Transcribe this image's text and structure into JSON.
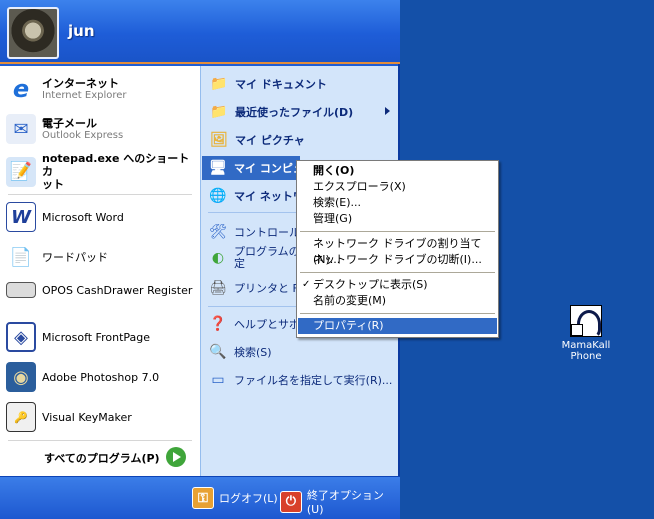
{
  "user": {
    "name": "jun"
  },
  "left_items": [
    {
      "title": "インターネット",
      "sub": "Internet Explorer"
    },
    {
      "title": "電子メール",
      "sub": "Outlook Express"
    },
    {
      "title": "notepad.exe へのショートカ",
      "title2": "ット"
    },
    {
      "title": "Microsoft Word"
    },
    {
      "title": "ワードパッド"
    },
    {
      "title": "OPOS CashDrawer Register"
    },
    {
      "title": "Microsoft FrontPage"
    },
    {
      "title": "Adobe Photoshop 7.0"
    },
    {
      "title": "Visual KeyMaker"
    }
  ],
  "all_programs": "すべてのプログラム(P)",
  "right_items": [
    {
      "label": "マイ ドキュメント"
    },
    {
      "label": "最近使ったファイル(D)"
    },
    {
      "label": "マイ ピクチャ"
    },
    {
      "label": "マイ コンピュ"
    },
    {
      "label": "マイ ネットワ"
    },
    {
      "label": "コントロール"
    },
    {
      "label": "プログラムのア",
      "label2": "定"
    },
    {
      "label": "プリンタと FA"
    },
    {
      "label": "ヘルプとサポ"
    },
    {
      "label": "検索(S)"
    },
    {
      "label": "ファイル名を指定して実行(R)..."
    }
  ],
  "footer": {
    "logoff": "ログオフ(L)",
    "shutdown": "終了オプション(U)"
  },
  "context_menu": [
    {
      "label": "開く(O)"
    },
    {
      "label": "エクスプローラ(X)"
    },
    {
      "label": "検索(E)..."
    },
    {
      "label": "管理(G)"
    },
    {
      "label": "ネットワーク ドライブの割り当て(N)..."
    },
    {
      "label": "ネットワーク ドライブの切断(I)..."
    },
    {
      "label": "デスクトップに表示(S)"
    },
    {
      "label": "名前の変更(M)"
    },
    {
      "label": "プロパティ(R)"
    }
  ],
  "desktop_icon": {
    "line1": "MamaKall",
    "line2": "Phone"
  },
  "colors": {
    "highlight": "#316ac5",
    "desktop": "#1450a8",
    "start_blue": "#1f5dd4"
  }
}
